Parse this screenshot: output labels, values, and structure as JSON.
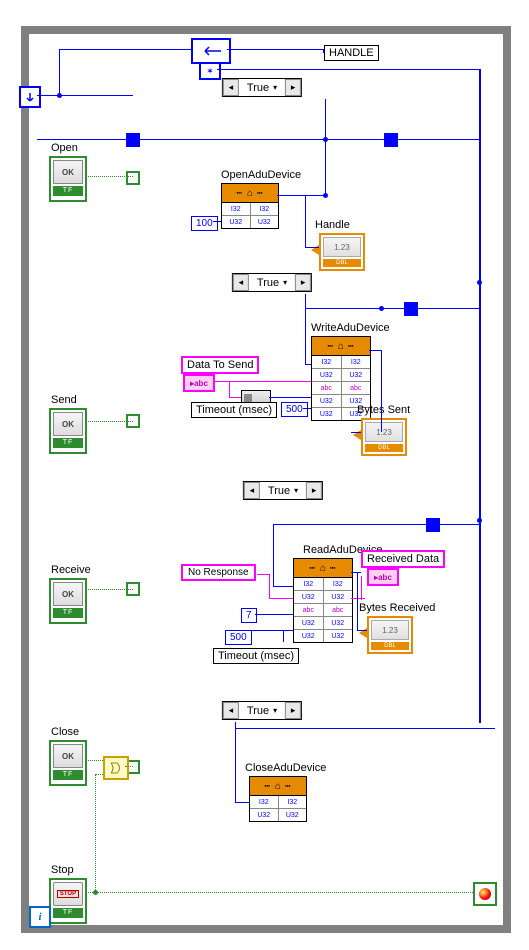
{
  "handle_label": "HANDLE",
  "open": {
    "btn": "Open",
    "selector": "True",
    "fn": "OpenAduDevice",
    "const": "100",
    "indicator": "Handle",
    "indval": "1.23"
  },
  "send": {
    "btn": "Send",
    "selector": "True",
    "fn": "WriteAduDevice",
    "data_label": "Data To Send",
    "timeout_label": "Timeout (msec)",
    "timeout": "500",
    "indicator": "Bytes Sent",
    "indval": "1.23"
  },
  "receive": {
    "btn": "Receive",
    "selector": "True",
    "fn": "ReadAduDevice",
    "noresp": "No Response",
    "rdata": "Received Data",
    "seven": "7",
    "timeout": "500",
    "timeout_label": "Timeout (msec)",
    "indicator": "Bytes Received",
    "indval": "1.23"
  },
  "close": {
    "btn": "Close",
    "selector": "True",
    "fn": "CloseAduDevice"
  },
  "stop": {
    "btn": "Stop"
  },
  "ok_text": "OK",
  "tf_text": "TF",
  "dbl_text": "DBL",
  "stop_text": "STOP",
  "abc": "abc",
  "chart_data": null
}
